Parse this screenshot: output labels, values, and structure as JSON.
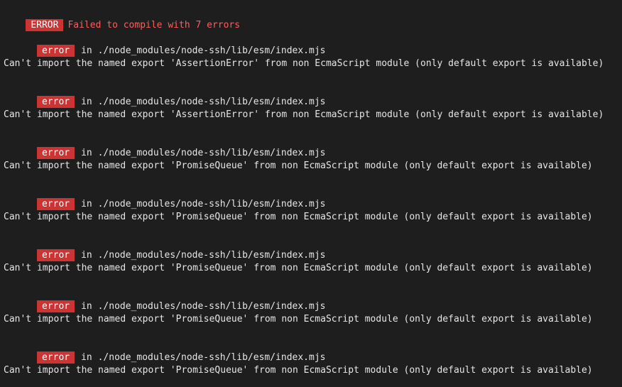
{
  "header": {
    "badge": "ERROR",
    "message": "Failed to compile with 7 errors"
  },
  "errors": [
    {
      "badge": "error",
      "location": "in ./node_modules/node-ssh/lib/esm/index.mjs",
      "message": "Can't import the named export 'AssertionError' from non EcmaScript module (only default export is available)"
    },
    {
      "badge": "error",
      "location": "in ./node_modules/node-ssh/lib/esm/index.mjs",
      "message": "Can't import the named export 'AssertionError' from non EcmaScript module (only default export is available)"
    },
    {
      "badge": "error",
      "location": "in ./node_modules/node-ssh/lib/esm/index.mjs",
      "message": "Can't import the named export 'PromiseQueue' from non EcmaScript module (only default export is available)"
    },
    {
      "badge": "error",
      "location": "in ./node_modules/node-ssh/lib/esm/index.mjs",
      "message": "Can't import the named export 'PromiseQueue' from non EcmaScript module (only default export is available)"
    },
    {
      "badge": "error",
      "location": "in ./node_modules/node-ssh/lib/esm/index.mjs",
      "message": "Can't import the named export 'PromiseQueue' from non EcmaScript module (only default export is available)"
    },
    {
      "badge": "error",
      "location": "in ./node_modules/node-ssh/lib/esm/index.mjs",
      "message": "Can't import the named export 'PromiseQueue' from non EcmaScript module (only default export is available)"
    },
    {
      "badge": "error",
      "location": "in ./node_modules/node-ssh/lib/esm/index.mjs",
      "message": "Can't import the named export 'PromiseQueue' from non EcmaScript module (only default export is available)"
    }
  ],
  "colors": {
    "background": "#1e1e1e",
    "badge": "#cc3333",
    "header_text": "#ff5c5c",
    "text": "#e6e6e6"
  }
}
